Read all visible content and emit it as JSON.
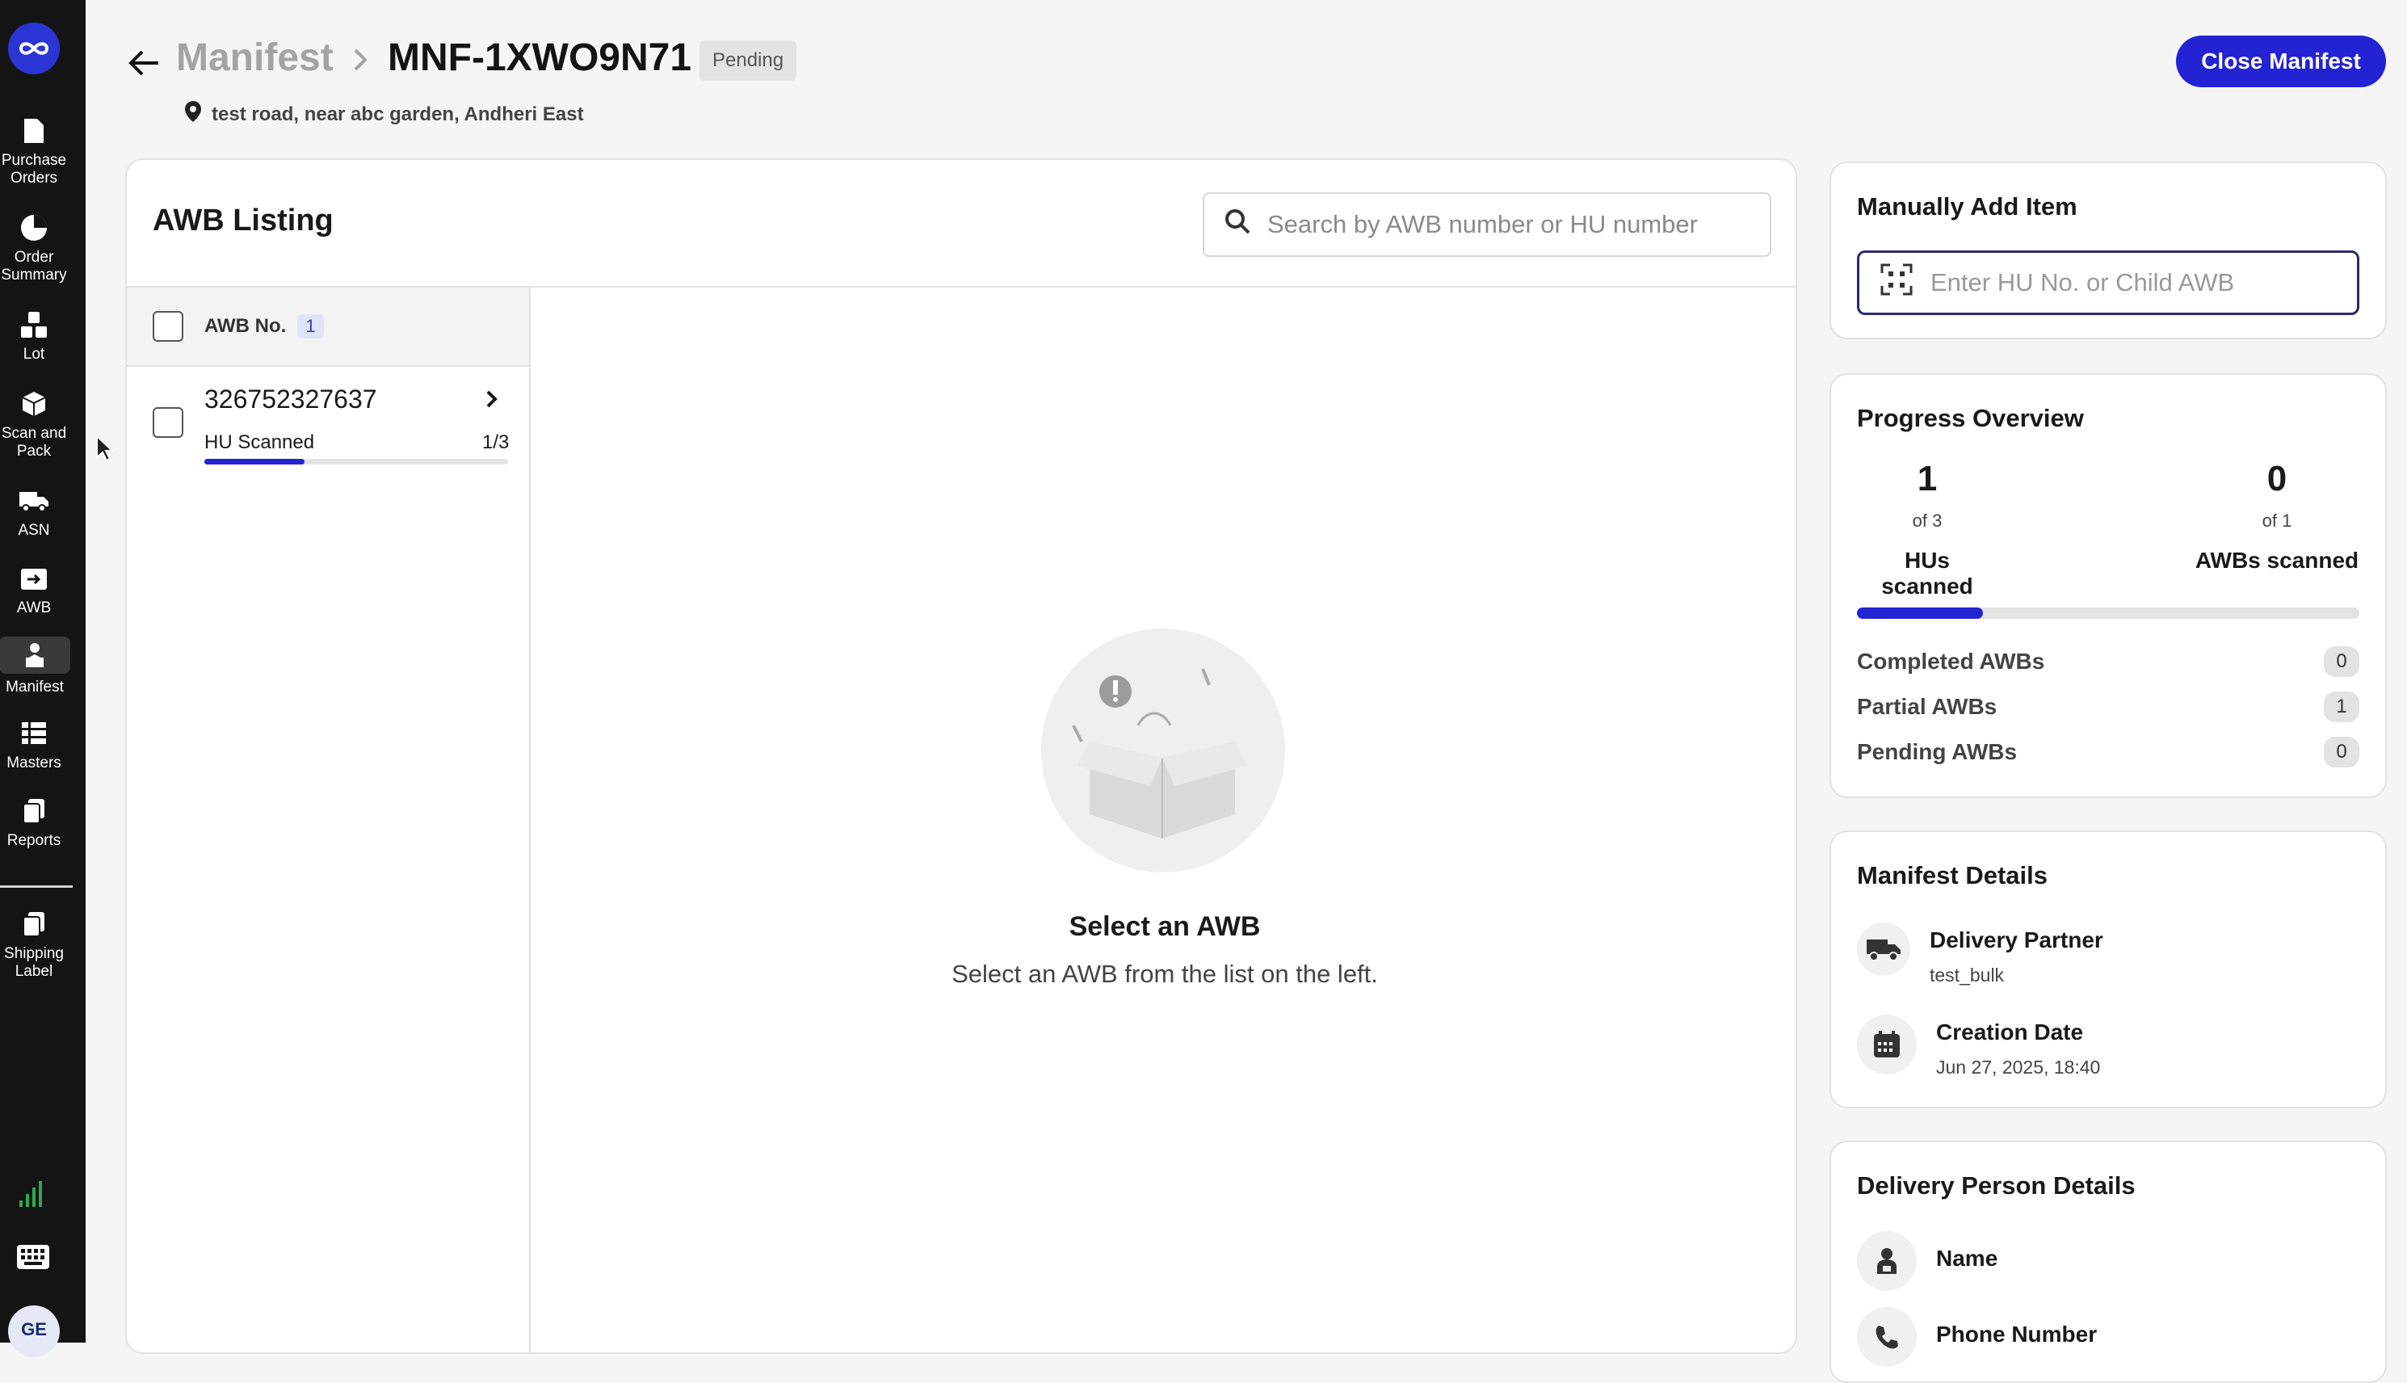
{
  "sidebar": {
    "items": [
      {
        "label": "Purchase\nOrders",
        "icon": "document-icon"
      },
      {
        "label": "Order\nSummary",
        "icon": "pie-chart-icon"
      },
      {
        "label": "Lot",
        "icon": "boxes-icon"
      },
      {
        "label": "Scan and\nPack",
        "icon": "package-icon"
      },
      {
        "label": "ASN",
        "icon": "truck-icon"
      },
      {
        "label": "AWB",
        "icon": "box-arrow-icon"
      },
      {
        "label": "Manifest",
        "icon": "person-box-icon"
      },
      {
        "label": "Masters",
        "icon": "list-icon"
      },
      {
        "label": "Reports",
        "icon": "copy-icon"
      },
      {
        "label": "Shipping\nLabel",
        "icon": "label-icon"
      }
    ],
    "avatar": "GE"
  },
  "header": {
    "crumb_root": "Manifest",
    "crumb_id": "MNF-1XWO9N71",
    "status": "Pending",
    "address": "test road, near abc garden, Andheri East",
    "close_button": "Close Manifest"
  },
  "awb_listing": {
    "title": "AWB Listing",
    "search_placeholder": "Search by AWB number or HU number",
    "column_label": "AWB No.",
    "count": "1",
    "rows": [
      {
        "awb": "326752327637",
        "status_label": "HU Scanned",
        "fraction": "1/3",
        "progress": 0.33
      }
    ],
    "empty_title": "Select an AWB",
    "empty_subtitle": "Select an AWB from the list on the left."
  },
  "manual_add": {
    "title": "Manually Add Item",
    "placeholder": "Enter HU No. or Child AWB"
  },
  "progress": {
    "title": "Progress Overview",
    "hus_value": "1",
    "hus_of": "of 3",
    "hus_caption": "HUs scanned",
    "awbs_value": "0",
    "awbs_of": "of 1",
    "awbs_caption": "AWBs scanned",
    "fraction": 0.25,
    "completed_label": "Completed AWBs",
    "completed_count": "0",
    "partial_label": "Partial AWBs",
    "partial_count": "1",
    "pending_label": "Pending AWBs",
    "pending_count": "0"
  },
  "manifest_details": {
    "title": "Manifest Details",
    "partner_label": "Delivery Partner",
    "partner_value": "test_bulk",
    "date_label": "Creation Date",
    "date_value": "Jun 27, 2025, 18:40"
  },
  "delivery_person": {
    "title": "Delivery Person Details",
    "name_label": "Name",
    "phone_label": "Phone Number"
  },
  "colors": {
    "accent": "#2323d3",
    "sidebar": "#141414"
  }
}
